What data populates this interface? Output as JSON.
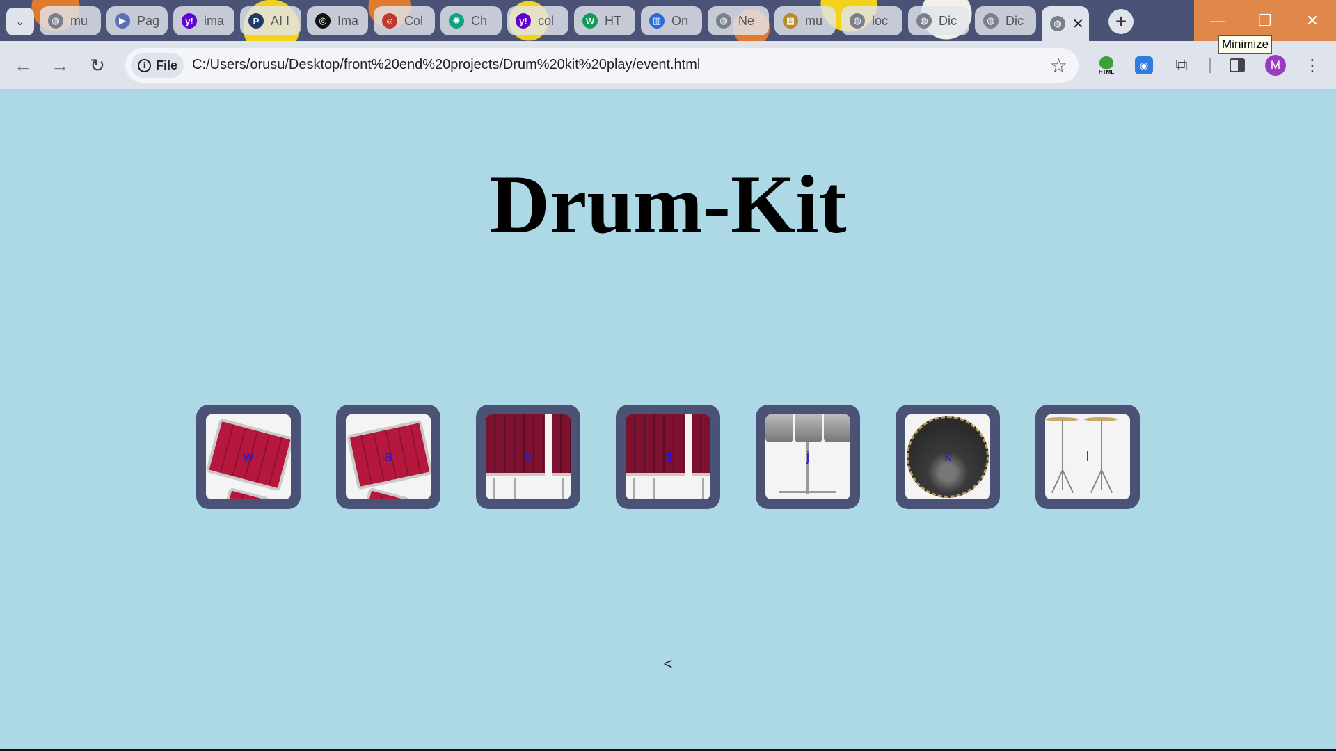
{
  "browser": {
    "tabs": [
      {
        "title": "mu",
        "favicon": "globe-icon",
        "color": "#7a7f8c"
      },
      {
        "title": "Pag",
        "favicon": "play-icon",
        "color": "#5b6fb5"
      },
      {
        "title": "ima",
        "favicon": "yahoo-icon",
        "color": "#6001d2"
      },
      {
        "title": "AI I",
        "favicon": "p-logo-icon",
        "color": "#1d3a6b"
      },
      {
        "title": "Ima",
        "favicon": "camera-lens-icon",
        "color": "#111111"
      },
      {
        "title": "Col",
        "favicon": "smiley-icon",
        "color": "#c0392b"
      },
      {
        "title": "Ch",
        "favicon": "chatgpt-icon",
        "color": "#10a37f"
      },
      {
        "title": "col",
        "favicon": "yahoo-icon",
        "color": "#6001d2"
      },
      {
        "title": "HT",
        "favicon": "w-logo-icon",
        "color": "#0d9d58"
      },
      {
        "title": "On",
        "favicon": "piano-icon",
        "color": "#2a6bd8"
      },
      {
        "title": "Ne",
        "favicon": "globe-icon",
        "color": "#7a7f8c"
      },
      {
        "title": "mu",
        "favicon": "thumbnail-icon",
        "color": "#b58a2a"
      },
      {
        "title": "loc",
        "favicon": "globe-icon",
        "color": "#7a7f8c"
      },
      {
        "title": "Dic",
        "favicon": "globe-icon",
        "color": "#7a7f8c"
      },
      {
        "title": "Dic",
        "favicon": "globe-icon",
        "color": "#7a7f8c"
      },
      {
        "title": "",
        "favicon": "globe-icon",
        "color": "#7a7f8c",
        "active": true
      }
    ],
    "tab_close_glyph": "✕",
    "new_tab_glyph": "+",
    "omnibox": {
      "chip_label": "File",
      "url": "C:/Users/orusu/Desktop/front%20end%20projects/Drum%20kit%20play/event.html"
    },
    "extensions": {
      "html_label": "HTML"
    },
    "avatar_initial": "M",
    "tooltip": "Minimize"
  },
  "page": {
    "title": "Drum-Kit",
    "drums": [
      {
        "key": "w",
        "kind": "tom"
      },
      {
        "key": "a",
        "kind": "tom"
      },
      {
        "key": "s",
        "kind": "floor"
      },
      {
        "key": "d",
        "kind": "floor"
      },
      {
        "key": "j",
        "kind": "snare"
      },
      {
        "key": "k",
        "kind": "kick"
      },
      {
        "key": "l",
        "kind": "cymbal"
      }
    ],
    "footer": "<"
  }
}
